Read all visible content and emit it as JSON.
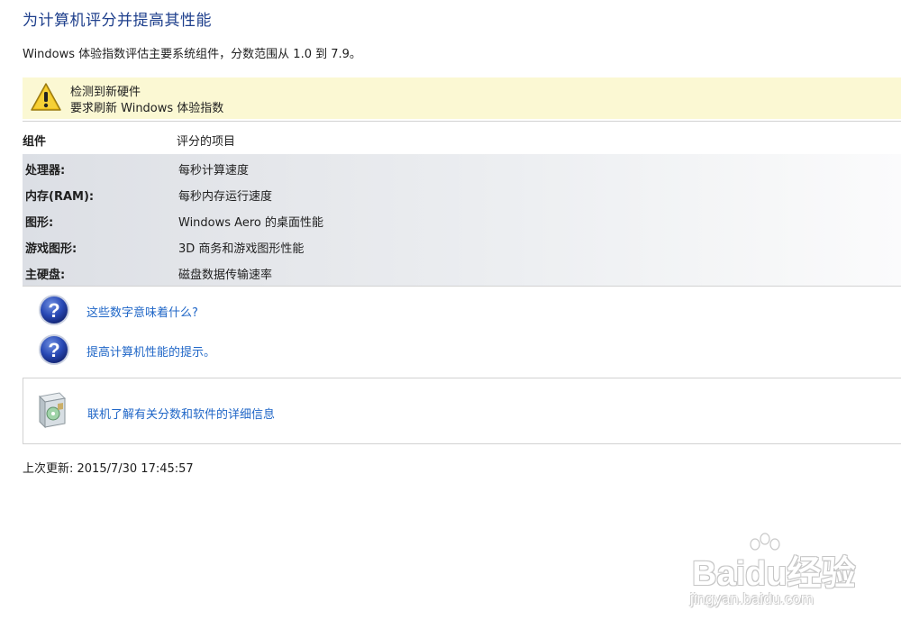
{
  "page": {
    "title": "为计算机评分并提高其性能",
    "intro": "Windows 体验指数评估主要系统组件，分数范围从 1.0 到 7.9。"
  },
  "warning": {
    "icon": "warning-icon",
    "line1": "检测到新硬件",
    "line2": "要求刷新 Windows 体验指数"
  },
  "table": {
    "header_component": "组件",
    "header_rated": "评分的项目",
    "rows": [
      {
        "label": "处理器:",
        "description": "每秒计算速度"
      },
      {
        "label": "内存(RAM):",
        "description": "每秒内存运行速度"
      },
      {
        "label": "图形:",
        "description": "Windows Aero 的桌面性能"
      },
      {
        "label": "游戏图形:",
        "description": "3D 商务和游戏图形性能"
      },
      {
        "label": "主硬盘:",
        "description": "磁盘数据传输速率"
      }
    ]
  },
  "help_links": [
    {
      "icon": "help-question-icon",
      "text": "这些数字意味着什么?"
    },
    {
      "icon": "help-question-icon",
      "text": "提高计算机性能的提示。"
    }
  ],
  "online": {
    "icon": "software-box-icon",
    "text": "联机了解有关分数和软件的详细信息"
  },
  "footer": {
    "last_updated": "上次更新: 2015/7/30 17:45:57"
  },
  "watermark": {
    "brand": "Baidu经验",
    "url": "jingyan.baidu.com"
  },
  "colors": {
    "title": "#1e3f8c",
    "link": "#1f66c7",
    "warning_bg": "#fbf8d3"
  }
}
